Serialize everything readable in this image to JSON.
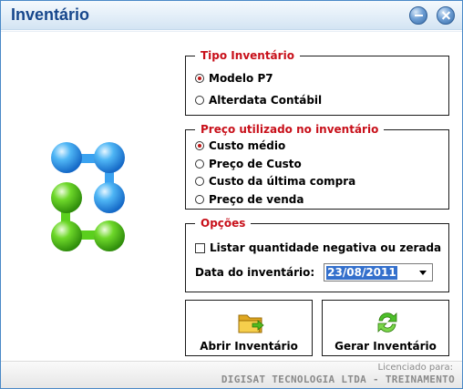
{
  "window": {
    "title": "Inventário"
  },
  "titlebar_buttons": {
    "minimize_icon": "minimize-icon",
    "close_icon": "close-icon"
  },
  "tipo_inventario": {
    "legend": "Tipo Inventário",
    "options": [
      {
        "label": "Modelo P7",
        "selected": true
      },
      {
        "label": "Alterdata Contábil",
        "selected": false
      }
    ]
  },
  "preco": {
    "legend": "Preço utilizado no inventário",
    "options": [
      {
        "label": "Custo médio",
        "selected": true
      },
      {
        "label": "Preço de Custo",
        "selected": false
      },
      {
        "label": "Custo da última compra",
        "selected": false
      },
      {
        "label": "Preço de venda",
        "selected": false
      }
    ]
  },
  "opcoes": {
    "legend": "Opções",
    "checkbox_label": "Listar quantidade negativa ou zerada",
    "checkbox_checked": false,
    "date_label": "Data do inventário:",
    "date_value": "23/08/2011"
  },
  "actions": {
    "abrir_label": "Abrir Inventário",
    "gerar_label": "Gerar Inventário"
  },
  "footer": {
    "licensed_label": "Licenciado para:",
    "licensee": "DIGISAT TECNOLOGIA LTDA - TREINAMENTO"
  },
  "colors": {
    "title": "#17478c",
    "legend": "#c8101a",
    "selection": "#3470cc",
    "logo_blue": "#3aa2f0",
    "logo_green": "#5bcf1e"
  }
}
